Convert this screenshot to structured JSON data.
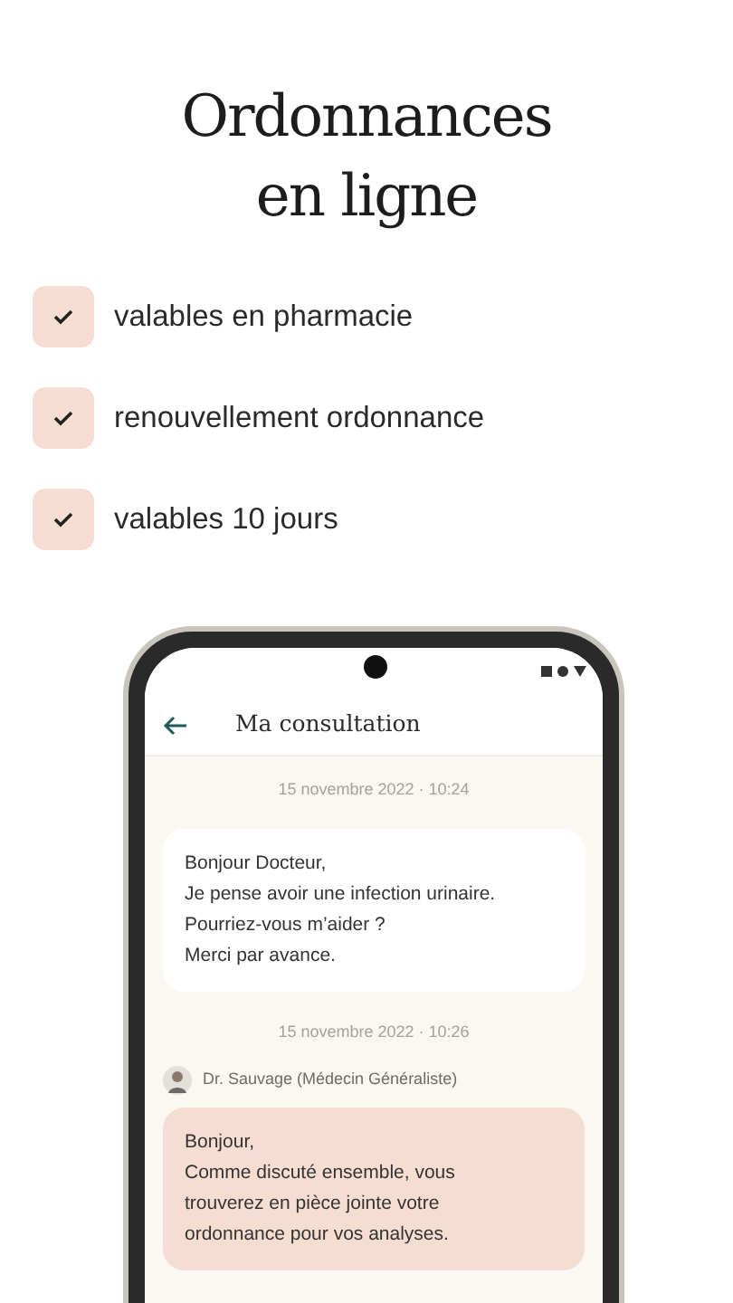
{
  "title": "Ordonnances en ligne",
  "features": [
    {
      "label": "valables en pharmacie",
      "checked": true
    },
    {
      "label": "renouvellement ordonnance",
      "checked": true
    },
    {
      "label": "valables 10 jours",
      "checked": true
    }
  ],
  "phone": {
    "header": {
      "title": "Ma consultation"
    },
    "messages": [
      {
        "kind": "time",
        "text": "15 novembre 2022 · 10:24"
      },
      {
        "kind": "patient",
        "lines": [
          "Bonjour Docteur,",
          "Je pense avoir une infection urinaire.",
          "Pourriez-vous m’aider ?",
          "Merci par avance."
        ]
      },
      {
        "kind": "time",
        "text": "15 novembre 2022 · 10:26"
      },
      {
        "kind": "sender",
        "text": "Dr. Sauvage (Médecin Généraliste)"
      },
      {
        "kind": "doctor",
        "lines": [
          "Bonjour,",
          "Comme discuté ensemble, vous trouverez en pièce jointe votre ordonnance pour vos analyses."
        ]
      }
    ]
  }
}
